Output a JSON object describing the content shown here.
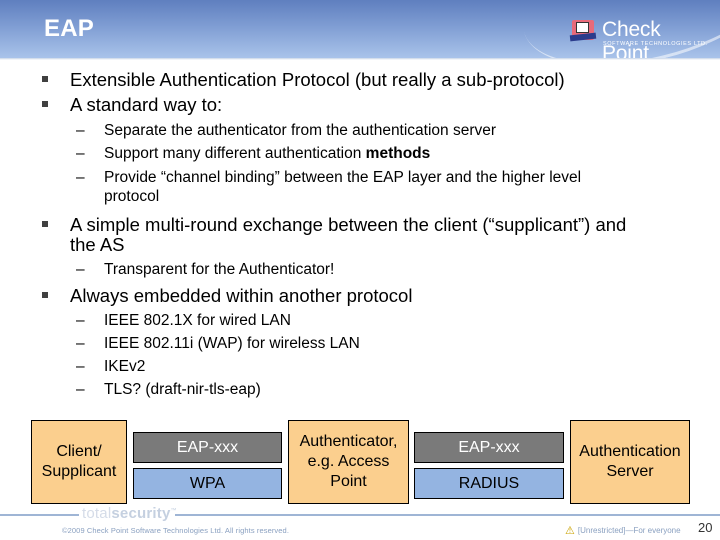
{
  "header": {
    "title": "EAP",
    "logo": {
      "icon": "check-point-logo-icon",
      "name": "Check Point",
      "subtitle": "SOFTWARE TECHNOLOGIES LTD."
    }
  },
  "bullets": [
    {
      "text": "Extensible Authentication Protocol (but really a sub-protocol)",
      "children": []
    },
    {
      "text": "A standard way to:",
      "children": [
        {
          "text": "Separate the authenticator from the authentication server"
        },
        {
          "text_before": "Support many different authentication ",
          "text_bold": "methods"
        },
        {
          "line1": "Provide “channel binding” between the EAP layer and the higher level",
          "line2": "protocol"
        }
      ]
    },
    {
      "line1": "A simple multi-round exchange between the client (“supplicant”) and",
      "line2": "the AS",
      "children": [
        {
          "text": "Transparent for the Authenticator!"
        }
      ]
    },
    {
      "text": "Always embedded within another protocol",
      "children": [
        {
          "text": "IEEE 802.1X for wired LAN"
        },
        {
          "text": "IEEE 802.11i (WAP) for wireless LAN"
        },
        {
          "text": "IKEv2"
        },
        {
          "text": "TLS? (draft-nir-tls-eap)"
        }
      ]
    }
  ],
  "diagram": {
    "client": {
      "line1": "Client/",
      "line2": "Supplicant"
    },
    "left_stack": {
      "top": "EAP-xxx",
      "bottom": "WPA"
    },
    "authenticator": {
      "line1": "Authenticator,",
      "line2": "e.g. Access",
      "line3": "Point"
    },
    "right_stack": {
      "top": "EAP-xxx",
      "bottom": "RADIUS"
    },
    "server": {
      "line1": "Authentication",
      "line2": "Server"
    },
    "colors": {
      "entity": "#fbcf8e",
      "eap": "#7a7a7a",
      "transport": "#94b4e1"
    }
  },
  "footer": {
    "brand_light": "total",
    "brand_bold": "security",
    "brand_mark": "™",
    "copyright": "©2009 Check Point Software Technologies Ltd. All rights reserved.",
    "classification_icon": "warning-triangle-icon",
    "classification": "[Unrestricted]—For everyone",
    "page_number": "20"
  }
}
